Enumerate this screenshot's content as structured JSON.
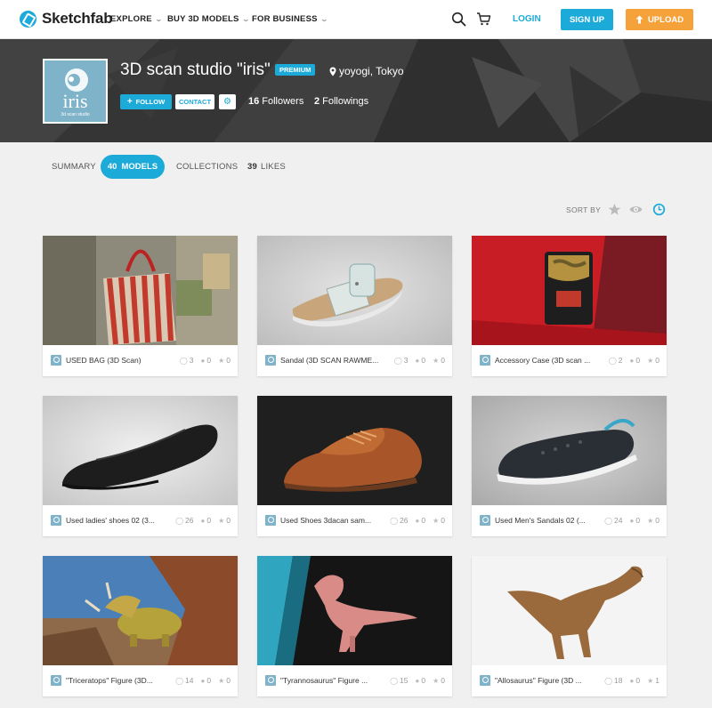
{
  "brand": {
    "name": "Sketchfab",
    "accent": "#1caad9",
    "upload_color": "#f6a23a"
  },
  "nav": {
    "links": [
      {
        "label": "EXPLORE"
      },
      {
        "label": "BUY 3D MODELS"
      },
      {
        "label": "FOR BUSINESS"
      }
    ],
    "icons": [
      "search-icon",
      "cart-icon"
    ],
    "login": "LOGIN",
    "signup": "SIGN UP",
    "upload": "UPLOAD"
  },
  "profile": {
    "avatar_text": "iris",
    "avatar_sub": "3d scan studio",
    "name": "3D scan studio \"iris\"",
    "badge": "PREMIUM",
    "location": "yoyogi, Tokyo",
    "follow": "FOLLOW",
    "contact": "CONTACT",
    "followers_count": "16",
    "followers_label": "Followers",
    "followings_count": "2",
    "followings_label": "Followings"
  },
  "tabs": {
    "summary": "SUMMARY",
    "models_count": "40",
    "models_label": "MODELS",
    "collections": "COLLECTIONS",
    "likes_count": "39",
    "likes_label": "LIKES"
  },
  "sort": {
    "label": "SORT BY",
    "options": [
      "star-icon",
      "eye-icon",
      "clock-icon"
    ],
    "active": "clock-icon"
  },
  "models": [
    {
      "title": "USED BAG (3D Scan)",
      "views": "3",
      "comments": "0",
      "likes": "0"
    },
    {
      "title": "Sandal (3D SCAN RAWME...",
      "views": "3",
      "comments": "0",
      "likes": "0"
    },
    {
      "title": "Accessory Case (3D scan ...",
      "views": "2",
      "comments": "0",
      "likes": "0"
    },
    {
      "title": "Used ladies' shoes 02 (3...",
      "views": "26",
      "comments": "0",
      "likes": "0"
    },
    {
      "title": "Used Shoes 3dacan sam...",
      "views": "26",
      "comments": "0",
      "likes": "0"
    },
    {
      "title": "Used Men's Sandals 02 (...",
      "views": "24",
      "comments": "0",
      "likes": "0"
    },
    {
      "title": "\"Triceratops\" Figure (3D...",
      "views": "14",
      "comments": "0",
      "likes": "0"
    },
    {
      "title": "\"Tyrannosaurus\" Figure ...",
      "views": "15",
      "comments": "0",
      "likes": "0"
    },
    {
      "title": "\"Allosaurus\" Figure (3D ...",
      "views": "18",
      "comments": "0",
      "likes": "1"
    }
  ]
}
